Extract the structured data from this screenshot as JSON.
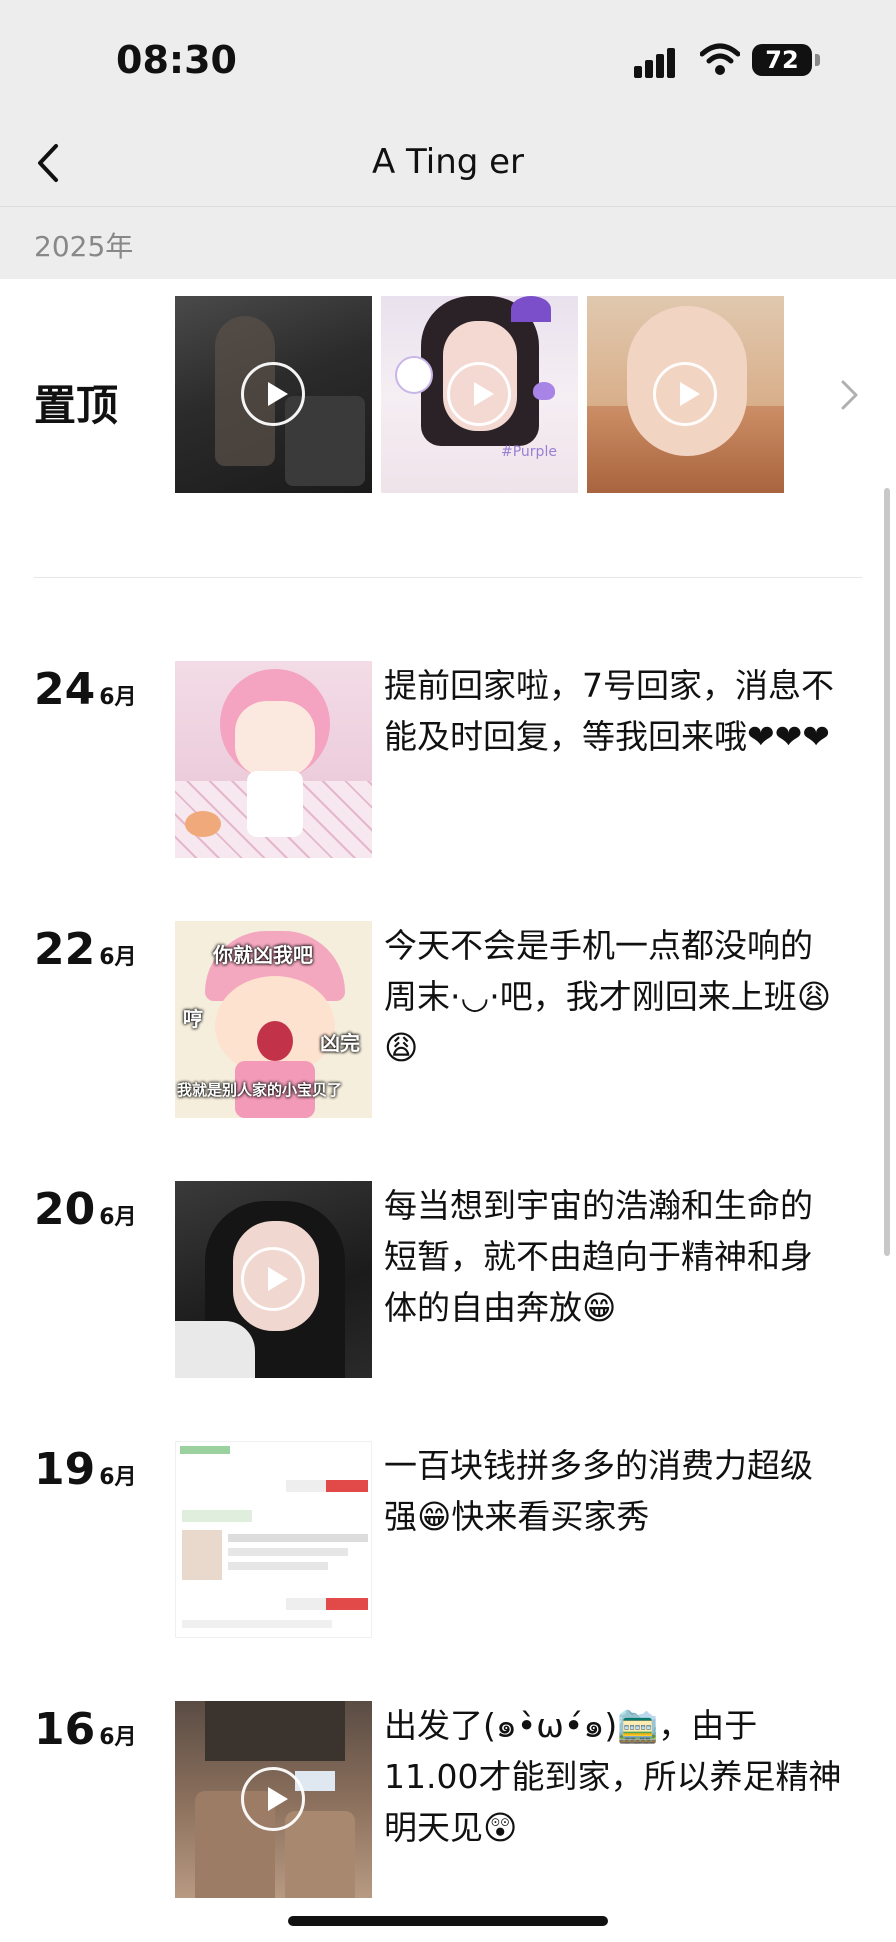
{
  "status_bar": {
    "time": "08:30",
    "battery": "72"
  },
  "nav": {
    "title": "A Ting er"
  },
  "year": "2025年",
  "pinned": {
    "label": "置顶"
  },
  "posts": [
    {
      "day": "24",
      "month": "6月",
      "text": "提前回家啦，7号回家，消息不能及时回复，等我回来哦❤❤❤"
    },
    {
      "day": "22",
      "month": "6月",
      "text": "今天不会是手机一点都没响的周末·◡·吧，我才刚回来上班😩😩"
    },
    {
      "day": "20",
      "month": "6月",
      "text": "每当想到宇宙的浩瀚和生命的短暂，就不由趋向于精神和身体的自由奔放😁"
    },
    {
      "day": "19",
      "month": "6月",
      "text": "一百块钱拼多多的消费力超级强😁快来看买家秀"
    },
    {
      "day": "16",
      "month": "6月",
      "text": "出发了(๑•̀ω•́๑)🚞，由于11.00才能到家，所以养足精神明天见😲"
    }
  ],
  "thumb_text": {
    "t2_top": "你就凶我吧",
    "t2_left": "哼",
    "t2_right": "凶完",
    "t2_bottom": "我就是别人家的小宝贝了",
    "pinned2_tag": "#Purple"
  },
  "colors": {
    "bar_bg": "#ededed",
    "text": "#111111",
    "muted": "#888888"
  }
}
